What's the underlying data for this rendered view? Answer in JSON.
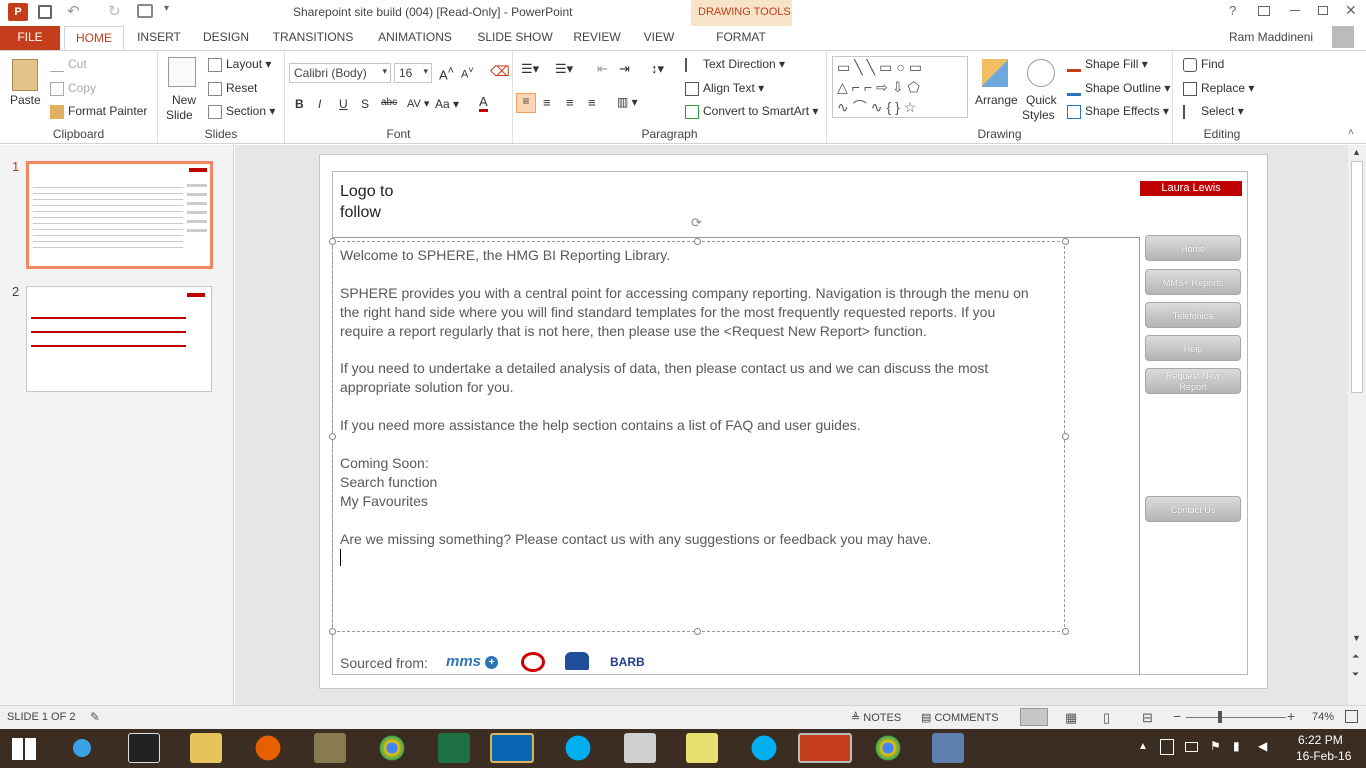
{
  "window": {
    "title": "Sharepoint site build (004) [Read-Only] - PowerPoint",
    "context_tab": "DRAWING TOOLS",
    "user": "Ram Maddineni"
  },
  "tabs": [
    "FILE",
    "HOME",
    "INSERT",
    "DESIGN",
    "TRANSITIONS",
    "ANIMATIONS",
    "SLIDE SHOW",
    "REVIEW",
    "VIEW",
    "FORMAT"
  ],
  "clipboard": {
    "paste": "Paste",
    "cut": "Cut",
    "copy": "Copy",
    "format_painter": "Format Painter",
    "label": "Clipboard"
  },
  "slides_grp": {
    "new_slide_1": "New",
    "new_slide_2": "Slide",
    "layout": "Layout",
    "reset": "Reset",
    "section": "Section",
    "label": "Slides"
  },
  "font": {
    "name": "Calibri (Body)",
    "size": "16",
    "label": "Font",
    "aa": "Aa"
  },
  "paragraph": {
    "text_direction": "Text Direction",
    "align_text": "Align Text",
    "convert_smartart": "Convert to SmartArt",
    "label": "Paragraph"
  },
  "drawing": {
    "arrange": "Arrange",
    "quick_1": "Quick",
    "quick_2": "Styles",
    "shape_fill": "Shape Fill",
    "shape_outline": "Shape Outline",
    "shape_effects": "Shape Effects",
    "label": "Drawing"
  },
  "editing": {
    "find": "Find",
    "replace": "Replace",
    "select": "Select",
    "label": "Editing"
  },
  "thumbs": {
    "n1": "1",
    "n2": "2"
  },
  "slide": {
    "logo_1": "Logo to",
    "logo_2": "follow",
    "user_badge": "Laura Lewis",
    "nav": [
      "Home",
      "MMS+ Reports",
      "Telefonica",
      "Help",
      "Request  New",
      "Report",
      "Contact  Us"
    ],
    "p1": "Welcome to SPHERE, the HMG BI Reporting Library.",
    "p2_1": "SPHERE provides you  with a central point for accessing company reporting. Navigation is through the menu on",
    "p2_2": "the right hand side where you will find standard templates for the most frequently requested reports.  If you",
    "p2_3": "require a report  regularly that is not here, then please use the <Request New Report> function.",
    "p3_1": "If you  need to undertake  a detailed analysis of data, then please contact us and we can discuss the most",
    "p3_2": "appropriate solution for you.",
    "p4": "If you  need more  assistance the help section contains a list of FAQ and user guides.",
    "p5_1": "Coming Soon:",
    "p5_2": "Search function",
    "p5_3": "My Favourites",
    "p6": "Are we missing something? Please contact us with any suggestions or feedback you may have.",
    "sourced": "Sourced from:",
    "logo_mms": "mms",
    "logo_barb": "BARB"
  },
  "status": {
    "slide_of": "SLIDE 1 OF 2",
    "notes": "NOTES",
    "comments": "COMMENTS",
    "zoom": "74%"
  },
  "clock": {
    "time": "6:22 PM",
    "date": "16-Feb-16"
  },
  "colors": {
    "accent": "#c43e1c",
    "badge": "#c00000",
    "drawing_tools": "#f7e4c8"
  }
}
